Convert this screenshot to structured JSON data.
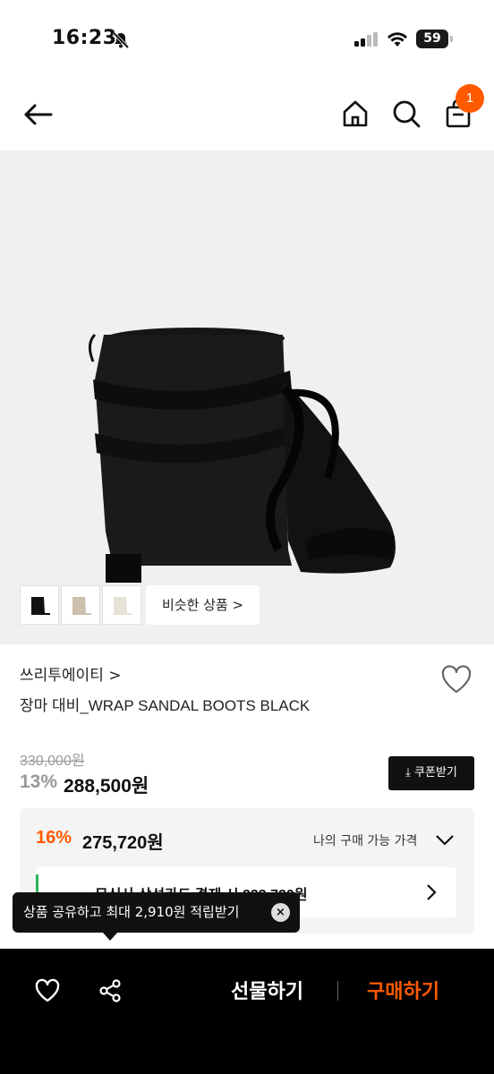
{
  "status_bar": {
    "time": "16:23",
    "battery": "59"
  },
  "header": {
    "cart_count": "1"
  },
  "gallery": {
    "similar_label": "비슷한 상품 >"
  },
  "product": {
    "brand": "쓰리투에이티 >",
    "name": "장마 대비_WRAP SANDAL BOOTS BLACK",
    "original_price": "330,000원",
    "discount_rate": "13%",
    "price": "288,500원",
    "coupon_label": "⤓ 쿠폰받기"
  },
  "my_price": {
    "discount_rate": "16%",
    "price": "275,720원",
    "label": "나의 구매 가능 가격",
    "card_offer": "무신사 삼성카드 결제 시 233,720원"
  },
  "toast": {
    "text": "상품 공유하고 최대 2,910원 적립받기",
    "close_icon": "×"
  },
  "bottom_bar": {
    "gift_label": "선물하기",
    "buy_label": "구매하기"
  },
  "colors": {
    "accent": "#ff5a00",
    "dark": "#111111",
    "hero_bg": "#f0f0f0"
  }
}
